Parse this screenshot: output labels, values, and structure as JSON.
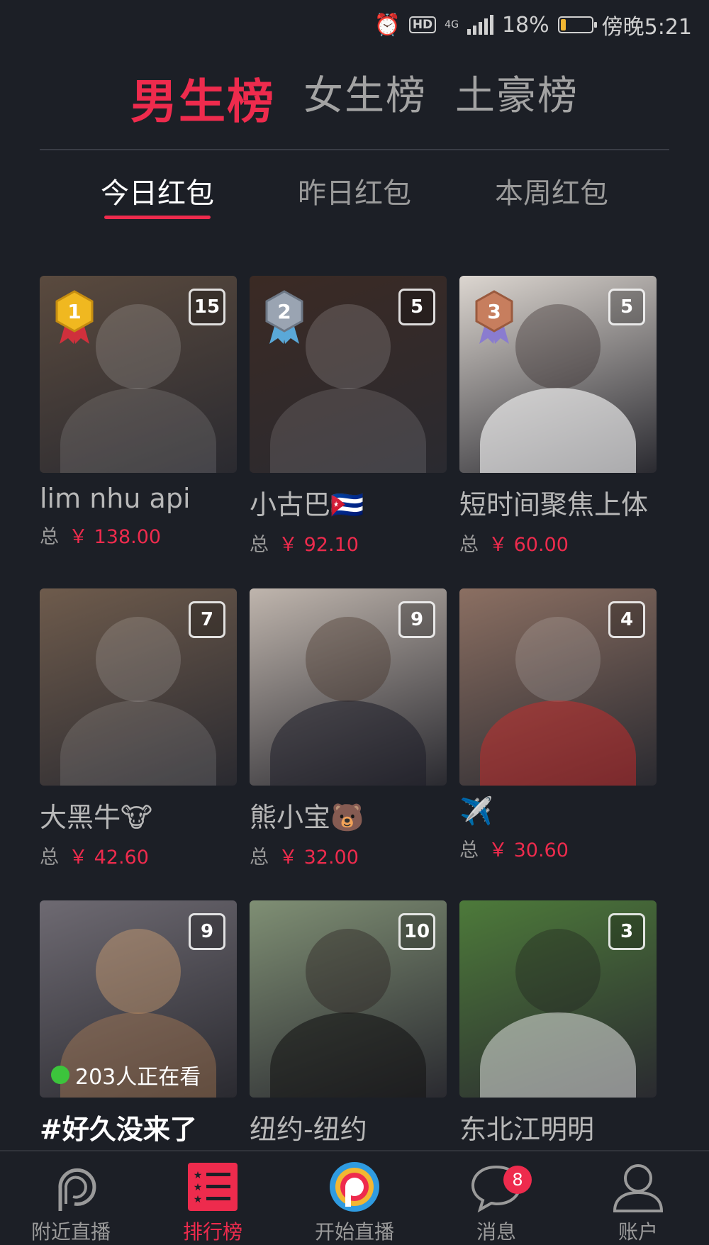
{
  "status_bar": {
    "network": "4G",
    "hd": "HD",
    "battery": "18%",
    "battery_level": 0.18,
    "time": "傍晚5:21"
  },
  "rank_tabs": [
    "男生榜",
    "女生榜",
    "土豪榜"
  ],
  "active_rank_tab": 0,
  "period_tabs": [
    "今日红包",
    "昨日红包",
    "本周红包"
  ],
  "active_period_tab": 0,
  "total_label": "总",
  "currency": "￥",
  "cards": [
    {
      "name": "lim nhu api",
      "count": "15",
      "medal": "1",
      "amount": "138.00"
    },
    {
      "name": "小古巴🇨🇺",
      "count": "5",
      "medal": "2",
      "amount": "92.10"
    },
    {
      "name": "短时间聚焦上体",
      "count": "5",
      "medal": "3",
      "amount": "60.00"
    },
    {
      "name": "大黑牛🐮",
      "count": "7",
      "amount": "42.60"
    },
    {
      "name": "熊小宝🐻",
      "count": "9",
      "amount": "32.00"
    },
    {
      "name": "✈️",
      "count": "4",
      "amount": "30.60"
    },
    {
      "name": "#好久没来了",
      "count": "9",
      "watching": "203人正在看"
    },
    {
      "name": "纽约-纽约",
      "count": "10"
    },
    {
      "name": "东北江明明",
      "count": "3"
    }
  ],
  "thumb_colors": [
    "#5a4a3e",
    "#3b2a24",
    "#dcd6d0",
    "#6e5b4c",
    "#bfb5ad",
    "#8b6f62",
    "#6e6a72",
    "#7f8f74",
    "#4d7a3a"
  ],
  "medal_colors": {
    "1": "#f0b820",
    "2": "#9aa4b2",
    "3": "#c77e5e"
  },
  "nav": [
    {
      "icon": "nearby-live-icon",
      "label": "附近直播"
    },
    {
      "icon": "ranking-icon",
      "label": "排行榜"
    },
    {
      "icon": "start-live-icon",
      "label": "开始直播"
    },
    {
      "icon": "message-icon",
      "label": "消息",
      "badge": "8"
    },
    {
      "icon": "account-icon",
      "label": "账户"
    }
  ],
  "active_nav": 1,
  "accent_color": "#ee2b4d"
}
